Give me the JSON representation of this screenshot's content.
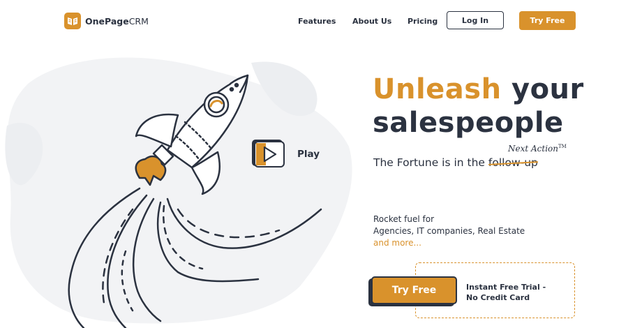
{
  "header": {
    "logo_bold": "OnePage",
    "logo_rest": "CRM",
    "nav": [
      {
        "label": "Features"
      },
      {
        "label": "About Us"
      },
      {
        "label": "Pricing"
      }
    ],
    "login_label": "Log In",
    "try_label": "Try Free"
  },
  "hero": {
    "title_accent": "Unleash",
    "title_rest": " your",
    "title_line2": "salespeople",
    "subtitle_prefix": "The Fortune is in the ",
    "subtitle_struck": "follow-up",
    "next_action": "Next Action",
    "next_action_tm": "TM",
    "play_label": "Play",
    "rocket_fuel_line1": "Rocket fuel for",
    "rocket_fuel_line2": "Agencies, IT companies, Real Estate",
    "more_link": "and more...",
    "cta_label": "Try Free",
    "trial_line1": "Instant Free Trial -",
    "trial_line2": "No Credit Card"
  },
  "colors": {
    "accent": "#d9922c",
    "dark": "#2b3240",
    "splash": "#f2f3f5"
  },
  "icons": [
    "logo-book-icon",
    "play-icon",
    "rocket-illustration"
  ]
}
